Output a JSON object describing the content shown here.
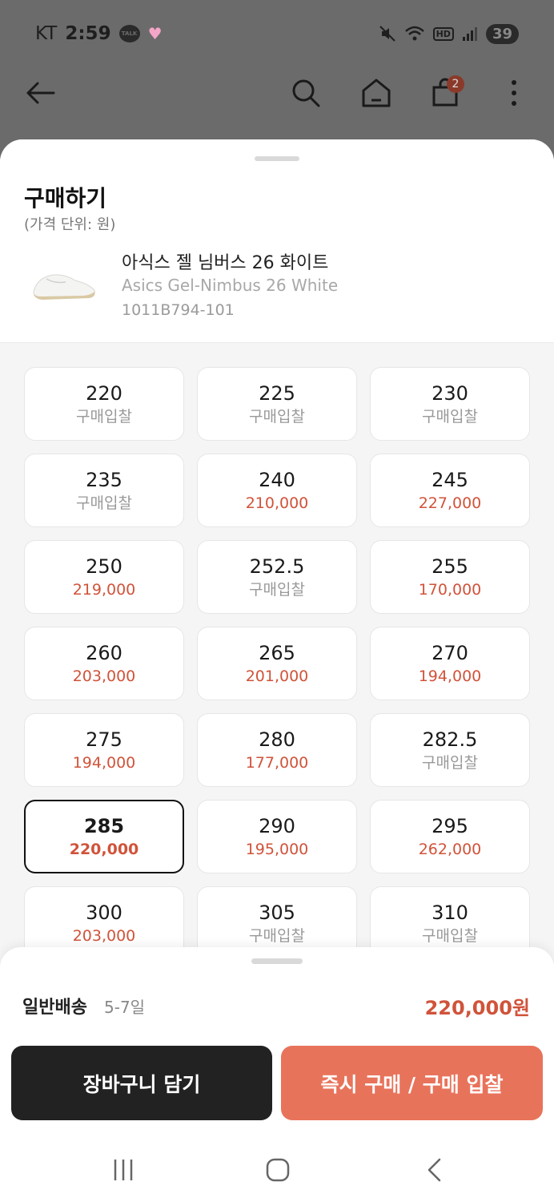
{
  "status_bar": {
    "carrier": "KT",
    "time": "2:59",
    "talk_badge": "TALK",
    "hd_label": "HD",
    "battery": "39"
  },
  "header": {
    "cart_count": "2"
  },
  "sheet": {
    "title": "구매하기",
    "price_unit": "(가격 단위: 원)"
  },
  "product": {
    "name_ko": "아식스 젤 님버스 26 화이트",
    "name_en": "Asics Gel-Nimbus 26 White",
    "code": "1011B794-101"
  },
  "sizes": [
    {
      "size": "220",
      "price": "구매입찰"
    },
    {
      "size": "225",
      "price": "구매입찰"
    },
    {
      "size": "230",
      "price": "구매입찰"
    },
    {
      "size": "235",
      "price": "구매입찰"
    },
    {
      "size": "240",
      "price": "210,000"
    },
    {
      "size": "245",
      "price": "227,000"
    },
    {
      "size": "250",
      "price": "219,000"
    },
    {
      "size": "252.5",
      "price": "구매입찰"
    },
    {
      "size": "255",
      "price": "170,000"
    },
    {
      "size": "260",
      "price": "203,000"
    },
    {
      "size": "265",
      "price": "201,000"
    },
    {
      "size": "270",
      "price": "194,000"
    },
    {
      "size": "275",
      "price": "194,000"
    },
    {
      "size": "280",
      "price": "177,000"
    },
    {
      "size": "282.5",
      "price": "구매입찰"
    },
    {
      "size": "285",
      "price": "220,000",
      "selected": true
    },
    {
      "size": "290",
      "price": "195,000"
    },
    {
      "size": "295",
      "price": "262,000"
    },
    {
      "size": "300",
      "price": "203,000"
    },
    {
      "size": "305",
      "price": "구매입찰"
    },
    {
      "size": "310",
      "price": "구매입찰"
    }
  ],
  "bottom": {
    "shipping_label": "일반배송",
    "shipping_days": "5-7일",
    "total_price": "220,000원",
    "cart_button": "장바구니 담기",
    "buy_button": "즉시 구매 / 구매 입찰"
  },
  "colors": {
    "accent": "#e8735b",
    "price_text": "#d0533a",
    "dark_button": "#222222"
  }
}
